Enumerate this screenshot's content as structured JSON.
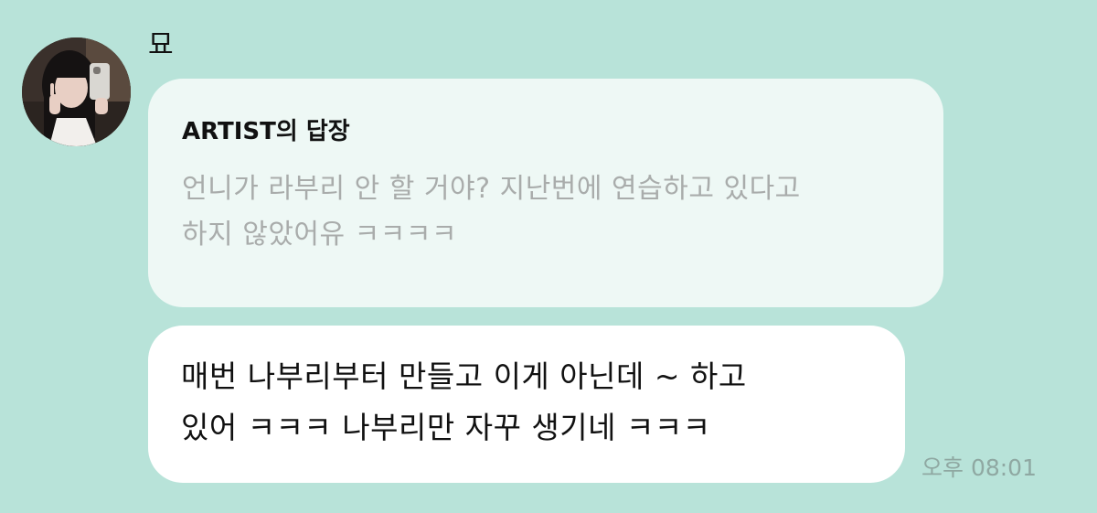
{
  "sender": {
    "name": "묘"
  },
  "reply": {
    "title": "ARTIST의 답장",
    "quote_lines": [
      "언니가 라부리 안 할 거야? 지난번에 연습하고 있다고",
      "하지 않았어유 ㅋㅋㅋㅋ"
    ]
  },
  "message": {
    "lines": [
      "매번 나부리부터 만들고 이게 아닌데 ~ 하고",
      "있어 ㅋㅋㅋ 나부리만 자꾸 생기네 ㅋㅋㅋ"
    ]
  },
  "timestamp": "오후 08:01",
  "colors": {
    "background": "#b8e3d9",
    "reply_bubble": "#eef8f5",
    "message_bubble": "#ffffff",
    "quote_text": "#a9acab",
    "timestamp": "#8fa8a2"
  }
}
